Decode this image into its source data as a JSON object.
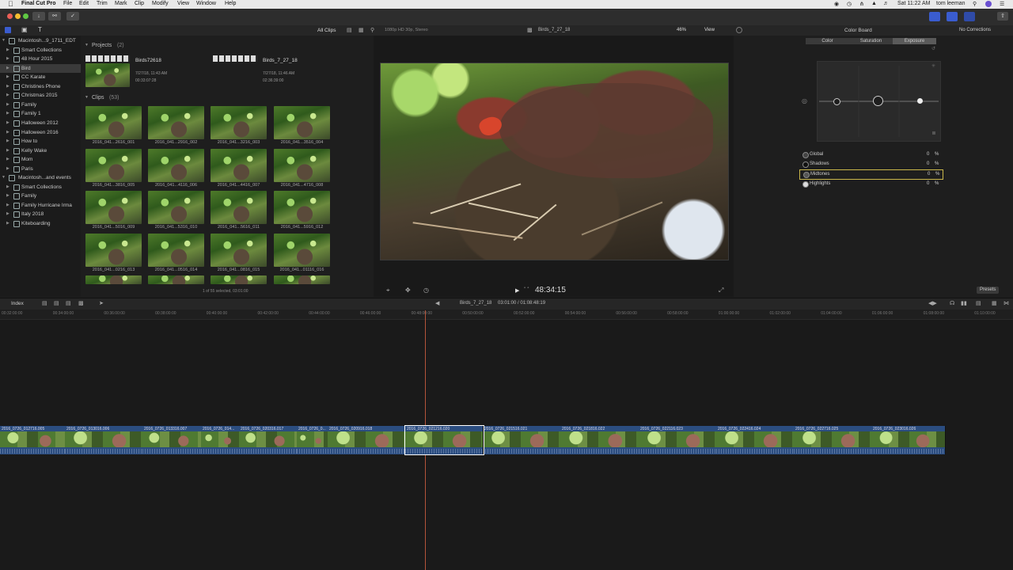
{
  "menubar": {
    "app": "Final Cut Pro",
    "items": [
      "File",
      "Edit",
      "Trim",
      "Mark",
      "Clip",
      "Modify",
      "View",
      "Window",
      "Help"
    ],
    "clock": "Sat 11:22 AM",
    "user": "tom leeman"
  },
  "browser_bar": {
    "filter": "All Clips"
  },
  "viewer_bar": {
    "format": "1080p HD 30p, Stereo",
    "project": "Birds_7_27_18",
    "zoom": "46%",
    "view": "View"
  },
  "inspector_bar": {
    "title": "Color Board",
    "corrections": "No Corrections"
  },
  "library": {
    "items": [
      {
        "label": "Macintosh...9_1711_EDT",
        "level": 0
      },
      {
        "label": "Smart Collections",
        "level": 1
      },
      {
        "label": "48 Hour 2015",
        "level": 1
      },
      {
        "label": "Bird",
        "level": 1,
        "selected": true
      },
      {
        "label": "CC Karate",
        "level": 1
      },
      {
        "label": "Christines Phone",
        "level": 1
      },
      {
        "label": "Christmas 2015",
        "level": 1
      },
      {
        "label": "Family",
        "level": 1
      },
      {
        "label": "Family 1",
        "level": 1
      },
      {
        "label": "Halloween 2012",
        "level": 1
      },
      {
        "label": "Halloween 2016",
        "level": 1
      },
      {
        "label": "How to",
        "level": 1
      },
      {
        "label": "Kelly Wake",
        "level": 1
      },
      {
        "label": "Mom",
        "level": 1
      },
      {
        "label": "Paris",
        "level": 1
      },
      {
        "label": "Macintosh...and events",
        "level": 0
      },
      {
        "label": "Smart Collections",
        "level": 1
      },
      {
        "label": "Family",
        "level": 1
      },
      {
        "label": "Family Hurricane Irma",
        "level": 1
      },
      {
        "label": "Italy 2018",
        "level": 1
      },
      {
        "label": "Kiteboarding",
        "level": 1
      }
    ]
  },
  "browser": {
    "projects_header": "Projects",
    "projects_count": "(2)",
    "projects": [
      {
        "name": "Birds72618",
        "date": "7/27/18, 11:43 AM",
        "duration": "00:33:07:28"
      },
      {
        "name": "Birds_7_27_18",
        "date": "7/27/18, 11:46 AM",
        "duration": "02:36:39:00"
      }
    ],
    "clips_header": "Clips",
    "clips_count": "(53)",
    "clips": [
      "2016_041...2616_001",
      "2016_041...2916_002",
      "2016_041...3216_003",
      "2016_041...3516_004",
      "2016_041...3816_005",
      "2016_041...4116_006",
      "2016_041...4416_007",
      "2016_041...4716_008",
      "2016_041...5016_009",
      "2016_041...5316_010",
      "2016_041...5616_011",
      "2016_041...5916_012",
      "2016_041...0216_013",
      "2016_041...0516_014",
      "2016_041...0816_015",
      "2016_041...01116_016"
    ],
    "status": "1 of 55 selected, 03:01:00"
  },
  "viewer": {
    "timecode": "48:34:15"
  },
  "color_board": {
    "tabs": [
      "Color",
      "Saturation",
      "Exposure"
    ],
    "active_tab": "Exposure",
    "rows": [
      {
        "name": "Global",
        "value": "0",
        "unit": "%"
      },
      {
        "name": "Shadows",
        "value": "0",
        "unit": "%"
      },
      {
        "name": "Midtones",
        "value": "0",
        "unit": "%",
        "selected": true
      },
      {
        "name": "Highlights",
        "value": "0",
        "unit": "%"
      }
    ],
    "presets": "Presets"
  },
  "timeline_bar": {
    "index": "Index",
    "project": "Birds_7_27_18",
    "position": "03:01:00 / 01:08:48:19"
  },
  "ruler": {
    "labels": [
      "00:32:00:00",
      "00:34:00:00",
      "00:36:00:00",
      "00:38:00:00",
      "00:40:00:00",
      "00:42:00:00",
      "00:44:00:00",
      "00:46:00:00",
      "00:48:00:00",
      "00:50:00:00",
      "00:52:00:00",
      "00:54:00:00",
      "00:56:00:00",
      "00:58:00:00",
      "01:00:00:00",
      "01:02:00:00",
      "01:04:00:00",
      "01:06:00:00",
      "01:08:00:00",
      "01:10:00:00"
    ]
  },
  "timeline": {
    "clips": [
      "2016_0726_012716.005",
      "2016_0726_013016.006",
      "2016_0726_013316.007",
      "2016_0726_014...",
      "2016_0726_020316.017",
      "2016_0726_0...",
      "2016_0726_020916.018",
      "2016_0726_021216.020",
      "2016_0726_021516.021",
      "2016_0726_021816.022",
      "2016_0726_022116.023",
      "2016_0726_022416.024",
      "2016_0726_022716.025",
      "2016_0726_023016.026"
    ]
  }
}
